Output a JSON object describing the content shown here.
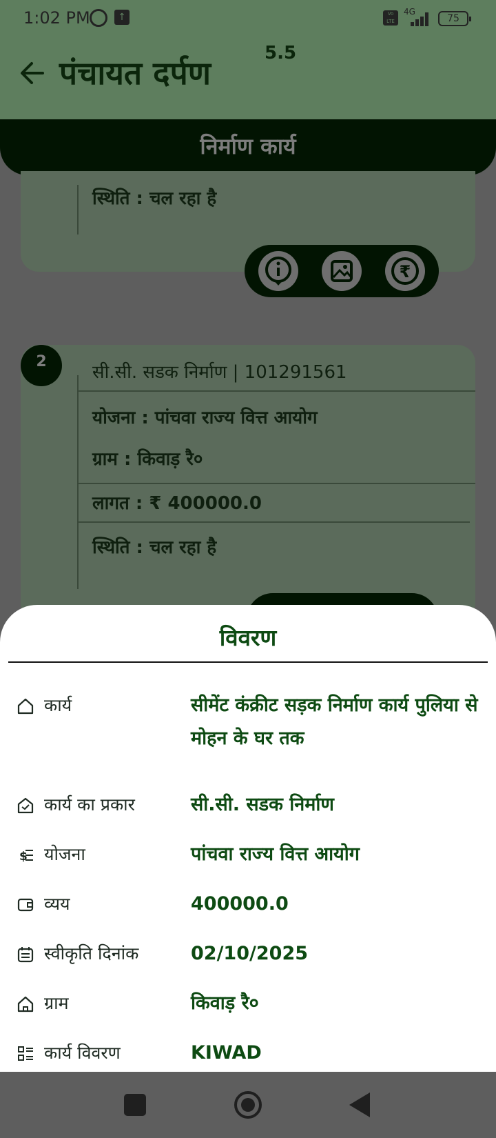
{
  "status": {
    "time": "1:02 PM",
    "network": "4G",
    "volte": "Vo LTE",
    "battery": "75"
  },
  "app": {
    "title": "पंचायत दर्पण",
    "version": "5.5"
  },
  "section": {
    "title": "निर्माण कार्य"
  },
  "cards": [
    {
      "status": "स्थिति : चल रहा है"
    },
    {
      "number": "2",
      "header": "सी.सी. सडक निर्माण | 101291561",
      "scheme": "योजना : पांचवा राज्य वित्त आयोग",
      "village": "ग्राम : किवाड़ रै०",
      "cost": "लागत : ₹ 400000.0",
      "status": "स्थिति : चल रहा है"
    }
  ],
  "actions": {
    "info_icon": "i",
    "image_icon": "▧",
    "rupee_icon": "₹"
  },
  "sheet": {
    "title": "विवरण",
    "rows": [
      {
        "icon": "home-outline-icon",
        "label": "कार्य",
        "value": "सीमेंट कंक्रीट सड़क निर्माण कार्य पुलिया से मोहन के घर तक"
      },
      {
        "icon": "house-check-icon",
        "label": "कार्य का प्रकार",
        "value": "सी.सी. सडक निर्माण"
      },
      {
        "icon": "dollar-list-icon",
        "label": "योजना",
        "value": "पांचवा राज्य वित्त आयोग"
      },
      {
        "icon": "wallet-icon",
        "label": "व्यय",
        "value": "400000.0"
      },
      {
        "icon": "calendar-icon",
        "label": "स्वीकृति दिनांक",
        "value": "02/10/2025"
      },
      {
        "icon": "village-home-icon",
        "label": "ग्राम",
        "value": "किवाड़ रै०"
      },
      {
        "icon": "list-details-icon",
        "label": "कार्य विवरण",
        "value": "KIWAD"
      }
    ]
  }
}
